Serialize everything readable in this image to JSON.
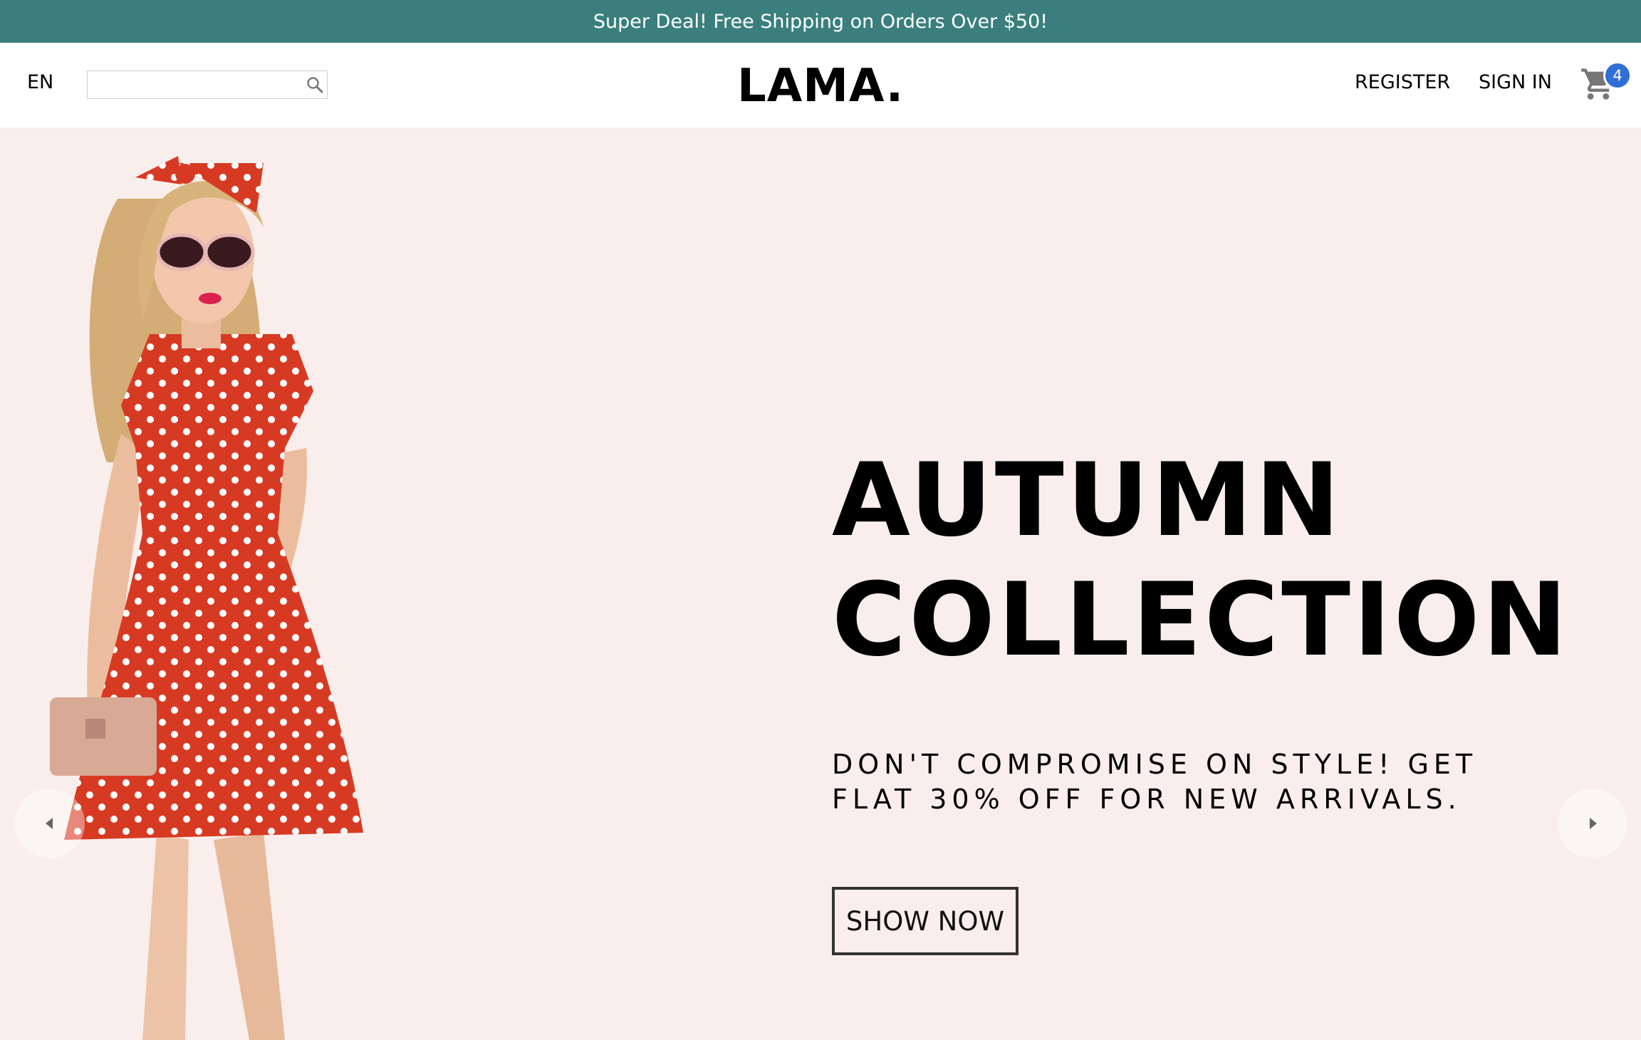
{
  "announcement": {
    "text": "Super Deal! Free Shipping on Orders Over $50!"
  },
  "navbar": {
    "language": "EN",
    "search": {
      "value": "",
      "placeholder": ""
    },
    "logo": "LAMA.",
    "links": {
      "register": "REGISTER",
      "sign_in": "SIGN IN"
    },
    "cart": {
      "count": "4",
      "icon": "shopping-cart-icon"
    }
  },
  "hero": {
    "title_line1": "AUTUMN",
    "title_line2": "COLLECTION",
    "description": "DON'T COMPROMISE ON STYLE! GET FLAT 30% OFF FOR NEW ARRIVALS.",
    "cta_label": "SHOW NOW",
    "image": "woman-in-red-polka-dot-dress",
    "arrows": {
      "left_icon": "arrow-left-icon",
      "right_icon": "arrow-right-icon"
    }
  },
  "colors": {
    "announcement_bg": "#3a7f7d",
    "hero_bg": "#f9eeeb",
    "badge_bg": "#2f6fd6",
    "dress_red": "#d73a23"
  }
}
